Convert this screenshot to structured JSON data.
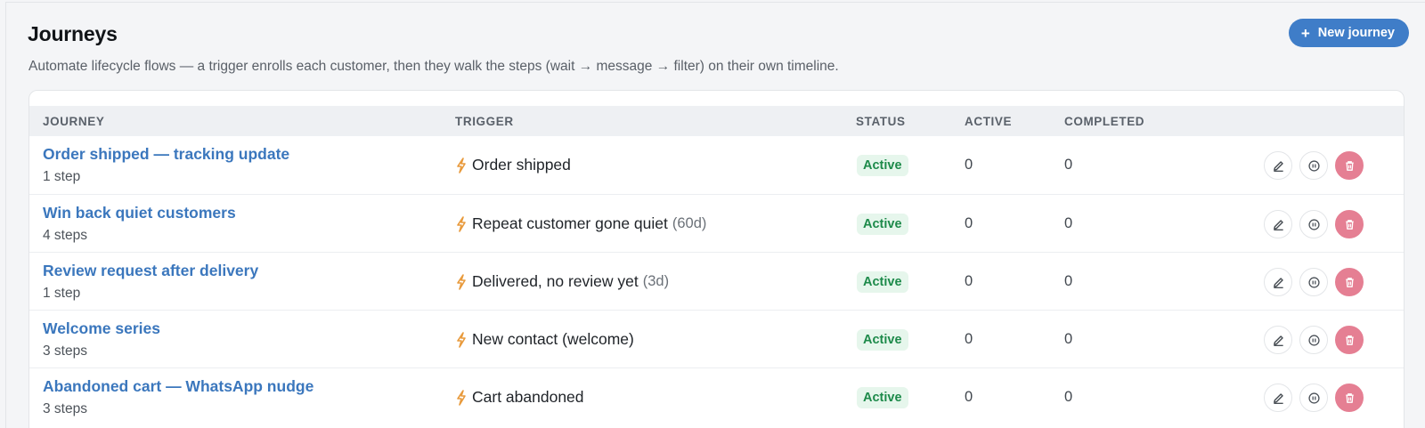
{
  "header": {
    "title": "Journeys",
    "subtitle": "Automate lifecycle flows — a trigger enrolls each customer, then they walk the steps (wait → message → filter) on their own timeline.",
    "new_button_label": "New journey"
  },
  "table": {
    "columns": [
      "JOURNEY",
      "TRIGGER",
      "STATUS",
      "ACTIVE",
      "COMPLETED"
    ],
    "rows": [
      {
        "name": "Order shipped — tracking update",
        "steps": "1 step",
        "trigger": "Order shipped",
        "trigger_qualifier": "",
        "status": "Active",
        "active": "0",
        "completed": "0"
      },
      {
        "name": "Win back quiet customers",
        "steps": "4 steps",
        "trigger": "Repeat customer gone quiet",
        "trigger_qualifier": "(60d)",
        "status": "Active",
        "active": "0",
        "completed": "0"
      },
      {
        "name": "Review request after delivery",
        "steps": "1 step",
        "trigger": "Delivered, no review yet",
        "trigger_qualifier": "(3d)",
        "status": "Active",
        "active": "0",
        "completed": "0"
      },
      {
        "name": "Welcome series",
        "steps": "3 steps",
        "trigger": "New contact (welcome)",
        "trigger_qualifier": "",
        "status": "Active",
        "active": "0",
        "completed": "0"
      },
      {
        "name": "Abandoned cart — WhatsApp nudge",
        "steps": "3 steps",
        "trigger": "Cart abandoned",
        "trigger_qualifier": "",
        "status": "Active",
        "active": "0",
        "completed": "0"
      }
    ],
    "row_icons": [
      "lightning-icon",
      "pencil-icon",
      "pause-icon",
      "trash-icon"
    ]
  },
  "colors": {
    "accent": "#3f7dc8",
    "link": "#3b77bd",
    "status_active_bg": "#e6f6ec",
    "status_active_text": "#1d8a4a",
    "delete": "#e57f93",
    "trigger_bolt": "#e89a3c"
  }
}
